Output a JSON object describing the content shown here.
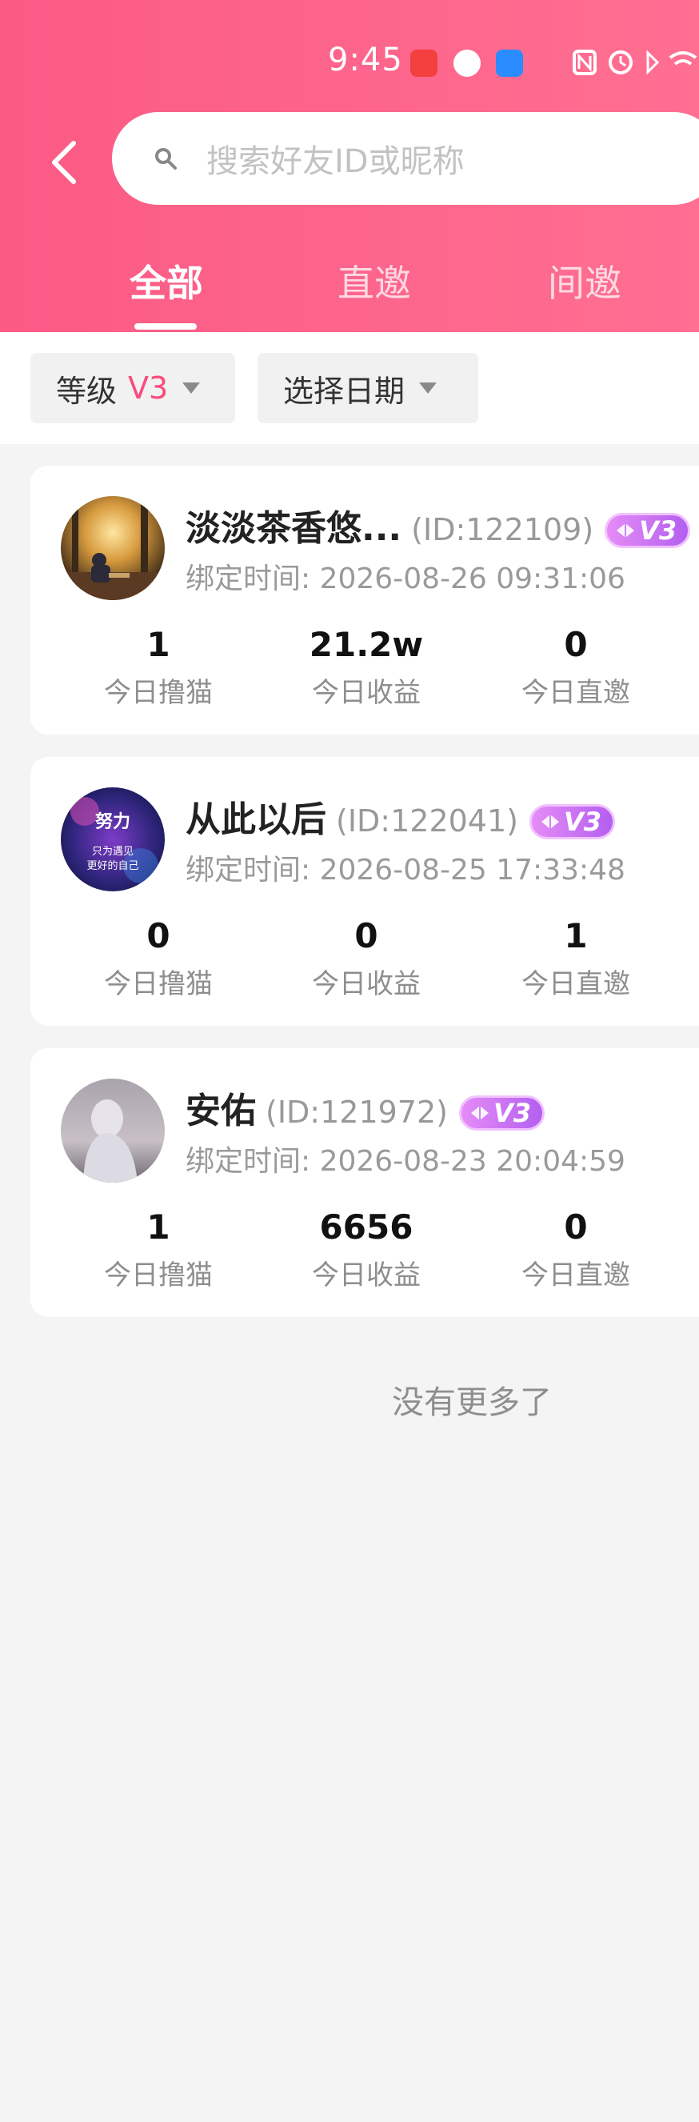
{
  "status_bar": {
    "time": "9:45"
  },
  "search": {
    "placeholder": "搜索好友ID或昵称"
  },
  "tabs": [
    {
      "label": "全部",
      "active": true
    },
    {
      "label": "直邀",
      "active": false
    },
    {
      "label": "间邀",
      "active": false
    }
  ],
  "filters": {
    "level_label": "等级",
    "level_value": "V3",
    "date_label": "选择日期"
  },
  "colors": {
    "accent": "#fa4a7c",
    "header_start": "#fb5a85",
    "header_end": "#ff6f92",
    "badge": "#b35ff0"
  },
  "friends": [
    {
      "name": "淡淡茶香悠...",
      "id": "(ID:122109)",
      "level": "V3",
      "bind_label": "绑定时间:",
      "bind_time": "2026-08-26 09:31:06",
      "stats": [
        {
          "value": "1",
          "label": "今日撸猫"
        },
        {
          "value": "21.2w",
          "label": "今日收益"
        },
        {
          "value": "0",
          "label": "今日直邀"
        }
      ]
    },
    {
      "name": "从此以后",
      "id": "(ID:122041)",
      "level": "V3",
      "bind_label": "绑定时间:",
      "bind_time": "2026-08-25 17:33:48",
      "avatar_text_top": "努力",
      "avatar_text_bottom_1": "只为遇见",
      "avatar_text_bottom_2": "更好的自己",
      "stats": [
        {
          "value": "0",
          "label": "今日撸猫"
        },
        {
          "value": "0",
          "label": "今日收益"
        },
        {
          "value": "1",
          "label": "今日直邀"
        }
      ]
    },
    {
      "name": "安佑",
      "id": "(ID:121972)",
      "level": "V3",
      "bind_label": "绑定时间:",
      "bind_time": "2026-08-23 20:04:59",
      "stats": [
        {
          "value": "1",
          "label": "今日撸猫"
        },
        {
          "value": "6656",
          "label": "今日收益"
        },
        {
          "value": "0",
          "label": "今日直邀"
        }
      ]
    }
  ],
  "footer": {
    "no_more": "没有更多了"
  }
}
